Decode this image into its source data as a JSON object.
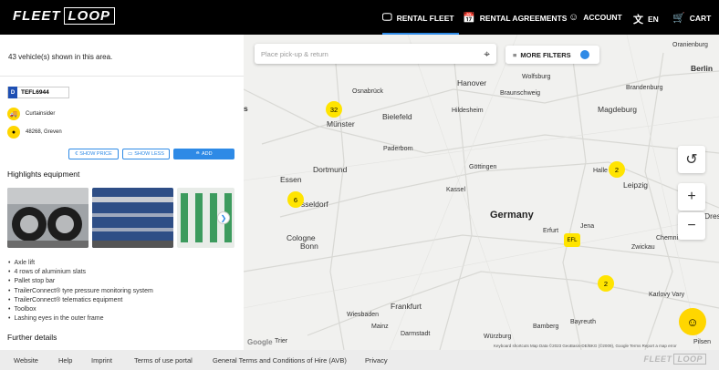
{
  "nav": {
    "logo_fleet": "FLEET",
    "logo_loop": "LOOP",
    "items": [
      {
        "label": "RENTAL FLEET",
        "icon": "monitor-icon"
      },
      {
        "label": "RENTAL AGREEMENTS",
        "icon": "calendar-icon"
      },
      {
        "label": "ACCOUNT",
        "icon": "user-circle-icon"
      },
      {
        "label": "EN",
        "icon": "translate-icon"
      },
      {
        "label": "CART",
        "icon": "cart-icon"
      }
    ],
    "accent_color": "#2e8ae6"
  },
  "panel": {
    "count_text": "43 vehicle(s) shown in this area.",
    "vehicle": {
      "plate_prefix": "D",
      "plate": "TEFL6944",
      "type": "Curtainsider",
      "location": "48268, Greven"
    },
    "buttons": {
      "show_price": "SHOW PRICE",
      "show_less": "SHOW LESS",
      "add": "ADD"
    },
    "highlights_title": "Highlights equipment",
    "equipment": [
      "Axle lift",
      "4 rows of aluminium slats",
      "Pallet stop bar",
      "TrailerConnect® tyre pressure monitoring system",
      "TrailerConnect® telematics equipment",
      "Toolbox",
      "Lashing eyes in the outer frame"
    ],
    "further_title": "Further details"
  },
  "map": {
    "search_placeholder": "Place pick-up & return",
    "more_filters": "MORE FILTERS",
    "country_label": "Germany",
    "cities": {
      "oranienburg": "Oranienburg",
      "berlin": "Berlin",
      "brandenburg": "Brandenburg",
      "osnabrueck": "Osnabrück",
      "hanover": "Hanover",
      "wolfsburg": "Wolfsburg",
      "braunschweig": "Braunschweig",
      "magdeburg": "Magdeburg",
      "bielefeld": "Bielefeld",
      "muenster": "Münster",
      "hildesheim": "Hildesheim",
      "paderborn": "Paderborn",
      "dortmund": "Dortmund",
      "essen": "Essen",
      "goettingen": "Göttingen",
      "halle": "Halle (",
      "leipzig": "Leipzig",
      "kassel": "Kassel",
      "duesseldorf": "sseldorf",
      "cologne": "Cologne",
      "bonn": "Bonn",
      "erfurt": "Erfurt",
      "jena": "Jena",
      "zwickau": "Zwickau",
      "chemnitz": "Chemni",
      "dresden": "Dres",
      "frankfurt": "Frankfurt",
      "wiesbaden": "Wiesbaden",
      "mainz": "Mainz",
      "darmstadt": "Darmstadt",
      "bamberg": "Bamberg",
      "bayreuth": "Bayreuth",
      "wuerzburg": "Würzburg",
      "karlovy_vary": "Karlovy Vary",
      "trier": "Trier",
      "plzen": "Pilsen",
      "edge_s": "s"
    },
    "clusters": [
      {
        "label": "32"
      },
      {
        "label": "6"
      },
      {
        "label": "2"
      },
      {
        "label": "2"
      }
    ],
    "marker_label": "EFL",
    "attribution": "Keyboard shortcuts    Map Data ©2023 GeoBasis-DE/BKG (©2009), Google    Terms    Report a map error",
    "google": "Google"
  },
  "footer": {
    "links": [
      "Website",
      "Help",
      "Imprint",
      "Terms of use portal",
      "General Terms and Conditions of Hire (AVB)",
      "Privacy"
    ],
    "logo_fleet": "FLEET",
    "logo_loop": "LOOP"
  }
}
